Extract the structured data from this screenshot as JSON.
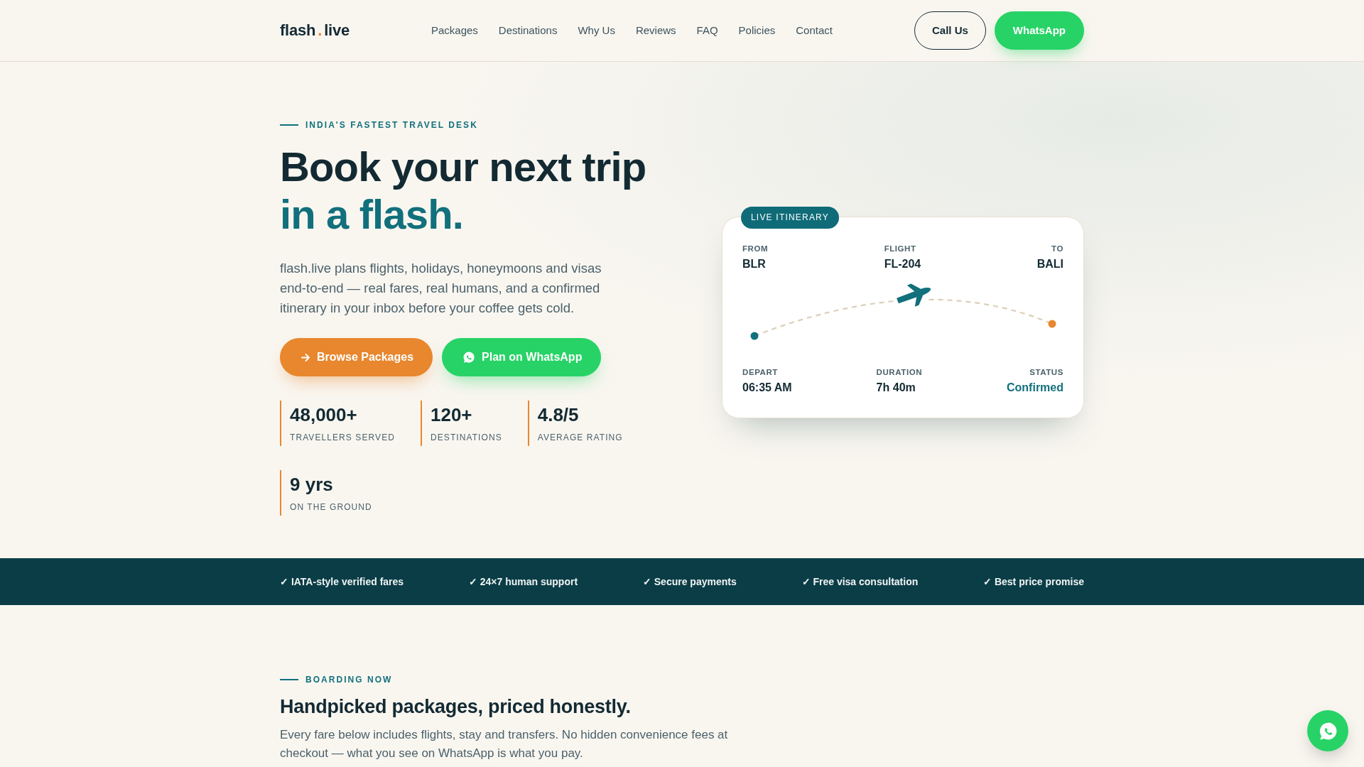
{
  "header": {
    "logo": {
      "word": "flash",
      "dot": ".",
      "domain": "live"
    },
    "nav": [
      "Packages",
      "Destinations",
      "Why Us",
      "Reviews",
      "FAQ",
      "Policies",
      "Contact"
    ],
    "actions": [
      {
        "label": "Call Us",
        "kind": "outline"
      },
      {
        "label": "WhatsApp",
        "kind": "whatsapp"
      }
    ]
  },
  "hero": {
    "eyebrow": "INDIA'S FASTEST TRAVEL DESK",
    "title": "Book your next trip",
    "title_accent": "in a flash.",
    "description": "flash.live plans flights, holidays, honeymoons and visas end-to-end — real fares, real humans, and a confirmed itinerary in your inbox before your coffee gets cold.",
    "buttons": [
      {
        "label": "Browse Packages",
        "kind": "primary"
      },
      {
        "label": "Plan on WhatsApp",
        "kind": "whatsapp"
      }
    ],
    "stats": [
      {
        "value": "48,000+",
        "label": "TRAVELLERS SERVED"
      },
      {
        "value": "120+",
        "label": "DESTINATIONS"
      },
      {
        "value": "4.8/5",
        "label": "AVERAGE RATING"
      },
      {
        "value": "9 yrs",
        "label": "ON THE GROUND"
      }
    ]
  },
  "itinerary_card": {
    "badge": "LIVE ITINERARY",
    "top": [
      {
        "label": "FROM",
        "value": "BLR",
        "kind": "plain"
      },
      {
        "label": "FLIGHT",
        "value": "FL-204",
        "kind": "plain"
      },
      {
        "label": "TO",
        "value": "BALI",
        "kind": "plain"
      }
    ],
    "bottom": [
      {
        "label": "DEPART",
        "value": "06:35 AM",
        "kind": "plain"
      },
      {
        "label": "DURATION",
        "value": "7h 40m",
        "kind": "plain"
      },
      {
        "label": "STATUS",
        "value": "Confirmed",
        "kind": "status"
      }
    ]
  },
  "trust_bar": [
    "✓ IATA-style verified fares",
    "✓ 24×7 human support",
    "✓ Secure payments",
    "✓ Free visa consultation",
    "✓ Best price promise"
  ],
  "packages_section": {
    "eyebrow": "BOARDING NOW",
    "heading": "Handpicked packages, priced honestly.",
    "description": "Every fare below includes flights, stay and transfers. No hidden convenience fees at checkout — what you see on WhatsApp is what you pay."
  }
}
